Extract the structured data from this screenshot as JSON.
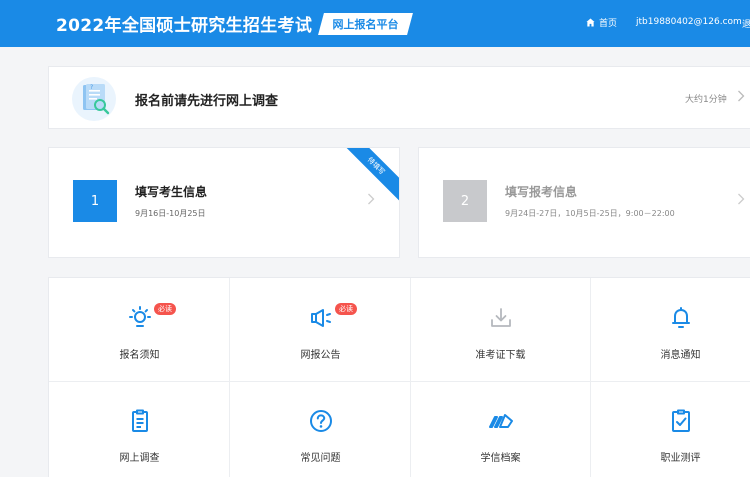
{
  "header": {
    "title": "2022年全国硕士研究生招生考试",
    "platform_label": "网上报名平台",
    "home_label": "首页",
    "email": "jtb19880402@126.com",
    "logout_label": "退"
  },
  "survey": {
    "text": "报名前请先进行网上调查",
    "time": "大约1分钟"
  },
  "steps": [
    {
      "number": "1",
      "title": "填写考生信息",
      "dates": "9月16日-10月25日",
      "ribbon": "待填写"
    },
    {
      "number": "2",
      "title": "填写报考信息",
      "dates": "9月24日-27日，10月5日-25日，9:00－22:00"
    }
  ],
  "grid": [
    {
      "label": "报名须知",
      "icon": "bulb-icon",
      "badge": "必读"
    },
    {
      "label": "网报公告",
      "icon": "megaphone-icon",
      "badge": "必读"
    },
    {
      "label": "准考证下载",
      "icon": "download-icon"
    },
    {
      "label": "消息通知",
      "icon": "bell-icon"
    },
    {
      "label": "网上调查",
      "icon": "clipboard-icon"
    },
    {
      "label": "常见问题",
      "icon": "question-icon"
    },
    {
      "label": "学信档案",
      "icon": "archive-icon"
    },
    {
      "label": "职业测评",
      "icon": "assessment-icon"
    }
  ],
  "colors": {
    "primary": "#1a8ae6",
    "badge": "#f5544d",
    "disabled": "#c8c9cc",
    "background": "#f4f5f7"
  }
}
